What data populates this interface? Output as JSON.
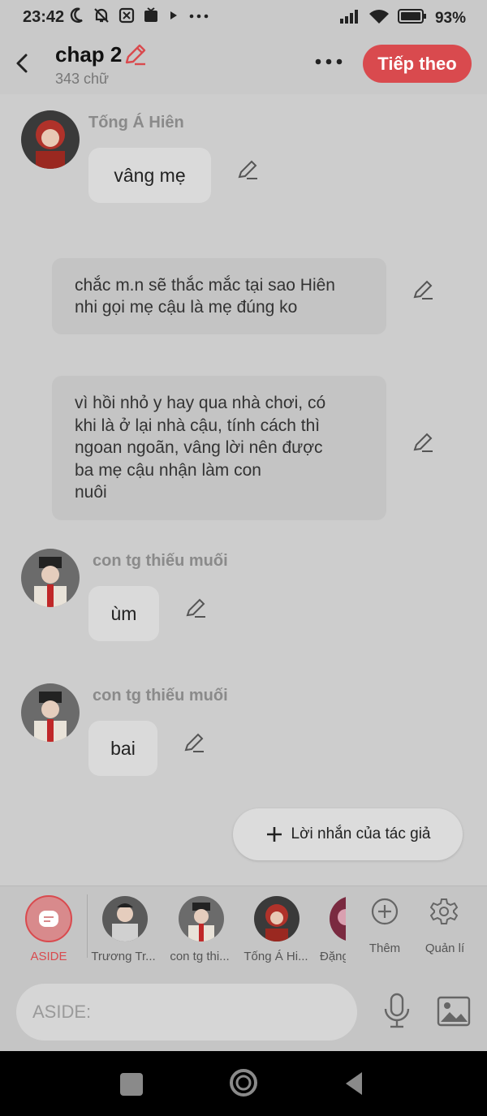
{
  "status": {
    "time": "23:42",
    "battery": "93%"
  },
  "header": {
    "title": "chap 2",
    "word_count": "343 chữ",
    "next_label": "Tiếp theo"
  },
  "messages": [
    {
      "sender": "Tống Á Hiên",
      "text": "vâng mẹ"
    },
    {
      "narration": [
        "chắc m.n sẽ thắc mắc tại sao Hiên",
        "nhi gọi mẹ cậu là mẹ đúng ko"
      ]
    },
    {
      "narration": [
        "vì hồi nhỏ y hay qua nhà chơi, có",
        "khi là ở lại nhà cậu, tính cách thì",
        "ngoan ngoãn, vâng lời nên được",
        "ba mẹ cậu nhận làm con",
        "nuôi"
      ]
    },
    {
      "sender": "con tg thiếu muối",
      "text": "ùm"
    },
    {
      "sender": "con tg thiếu muối",
      "text": "bai"
    }
  ],
  "author_note": {
    "label": "Lời nhắn của tác giả"
  },
  "characters": [
    {
      "label": "ASIDE"
    },
    {
      "label": "Trương Tr..."
    },
    {
      "label": "con tg thi..."
    },
    {
      "label": "Tống Á Hi..."
    },
    {
      "label": "Đặng"
    },
    {
      "label": "Thêm"
    },
    {
      "label": "Quản lí"
    }
  ],
  "input": {
    "placeholder": "ASIDE:"
  },
  "colors": {
    "accent": "#d94a4e",
    "background": "#cdcdcd",
    "bubble": "#dadada",
    "narration": "#c4c4c4"
  }
}
